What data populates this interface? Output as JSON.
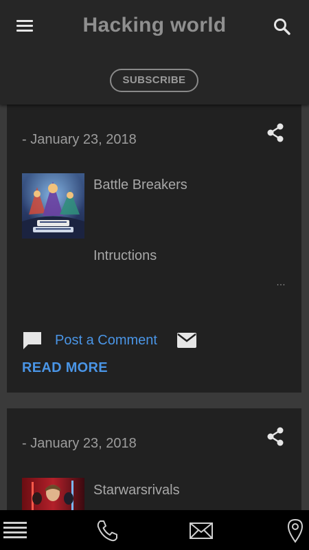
{
  "header": {
    "title": "Hacking world",
    "subscribe_label": "SUBSCRIBE"
  },
  "posts": [
    {
      "date": "- January 23, 2018",
      "title": "Battle Breakers",
      "thumb_alt": "Battle Breakers",
      "snippet": "Intructions",
      "more_marker": "…",
      "comment_label": "Post a Comment",
      "read_more_label": "READ MORE"
    },
    {
      "date": "- January 23, 2018",
      "title": "Starwarsrivals"
    }
  ],
  "icons": {
    "menu": "menu-icon",
    "search": "search-icon",
    "share": "share-icon",
    "comment": "comment-icon",
    "email": "email-icon",
    "phone": "phone-icon",
    "location": "location-pin-icon"
  },
  "colors": {
    "background": "#3a3a3a",
    "card": "#212121",
    "header": "#262626",
    "link": "#4a95e6",
    "text": "#a8a8a8",
    "bottom_bar": "#000000"
  }
}
